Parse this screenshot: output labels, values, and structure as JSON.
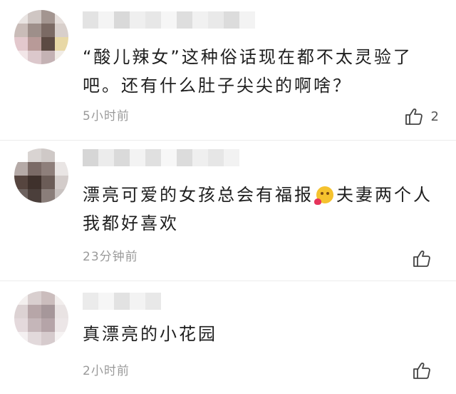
{
  "comments": [
    {
      "text_lines": [
        "“酸儿辣女”这种俗话现在都不太灵验了",
        "吧。还有什么肚子尖尖的啊啥？"
      ],
      "time": "5小时前",
      "likes": "2",
      "avatar_icon": "avatar-pixelated",
      "like_icon": "thumbs-up-icon"
    },
    {
      "text_line1_before_emoji": "漂亮可爱的女孩总会有福报",
      "text_line1_after_emoji": "夫妻两个人",
      "text_line2": "我都好喜欢",
      "emoji_icon": "face-blowing-kiss-emoji",
      "time": "23分钟前",
      "likes": "",
      "avatar_icon": "avatar-pixelated",
      "like_icon": "thumbs-up-icon"
    },
    {
      "text_line1": "真漂亮的小花园",
      "time": "2小时前",
      "likes": "",
      "avatar_icon": "avatar-pixelated",
      "like_icon": "thumbs-up-icon"
    }
  ],
  "colors": {
    "text": "#1e1e1e",
    "time": "#9a9a9a",
    "divider": "#ececec",
    "icon": "#444444"
  }
}
